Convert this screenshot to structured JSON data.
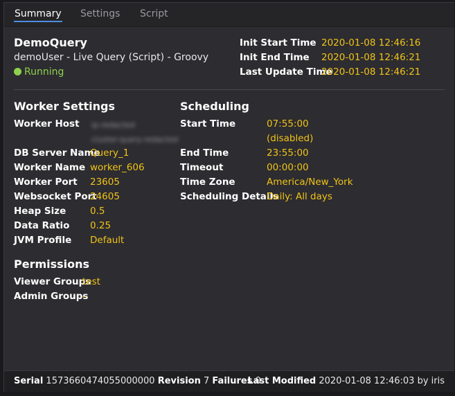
{
  "tabs": [
    "Summary",
    "Settings",
    "Script"
  ],
  "header": {
    "query_name": "DemoQuery",
    "description": "demoUser - Live Query (Script) - Groovy",
    "status": "Running",
    "init_start_label": "Init Start Time",
    "init_start_value": "2020-01-08 12:46:16",
    "init_end_label": "Init End Time",
    "init_end_value": "2020-01-08 12:46:21",
    "last_update_label": "Last Update Time",
    "last_update_value": "2020-01-08 12:46:21"
  },
  "worker_settings": {
    "title": "Worker Settings",
    "rows": [
      {
        "label": "Worker Host",
        "value": "ip-redacted"
      },
      {
        "label": "DB Server Name",
        "value": "Query_1"
      },
      {
        "label": "Worker Name",
        "value": "worker_606"
      },
      {
        "label": "Worker Port",
        "value": "23605"
      },
      {
        "label": "Websocket Port",
        "value": "24605"
      },
      {
        "label": "Heap Size",
        "value": "0.5"
      },
      {
        "label": "Data Ratio",
        "value": "0.25"
      },
      {
        "label": "JVM Profile",
        "value": "Default"
      }
    ],
    "worker_host_line2": "cluster-query-redacted"
  },
  "scheduling": {
    "title": "Scheduling",
    "rows": [
      {
        "label": "Start Time",
        "value": "07:55:00"
      },
      {
        "label": "End Time",
        "value": "23:55:00"
      },
      {
        "label": "Timeout",
        "value": "00:00:00"
      },
      {
        "label": "Time Zone",
        "value": "America/New_York"
      },
      {
        "label": "Scheduling Details",
        "value": "Daily: All days"
      }
    ],
    "start_time_note": "(disabled)"
  },
  "permissions": {
    "title": "Permissions",
    "rows": [
      {
        "label": "Viewer Groups",
        "value": "test"
      },
      {
        "label": "Admin Groups",
        "value": "-"
      }
    ]
  },
  "footer": {
    "serial_label": "Serial",
    "serial_value": "1573660474055000000",
    "revision_label": "Revision",
    "revision_value": "7",
    "failures_label": "Failures",
    "failures_value": "0",
    "modified_label": "Last Modified",
    "modified_value": "2020-01-08 12:46:03 by iris"
  },
  "colors": {
    "accent": "#f0c419",
    "running": "#8fd14f",
    "tab_underline": "#4a90e2"
  }
}
